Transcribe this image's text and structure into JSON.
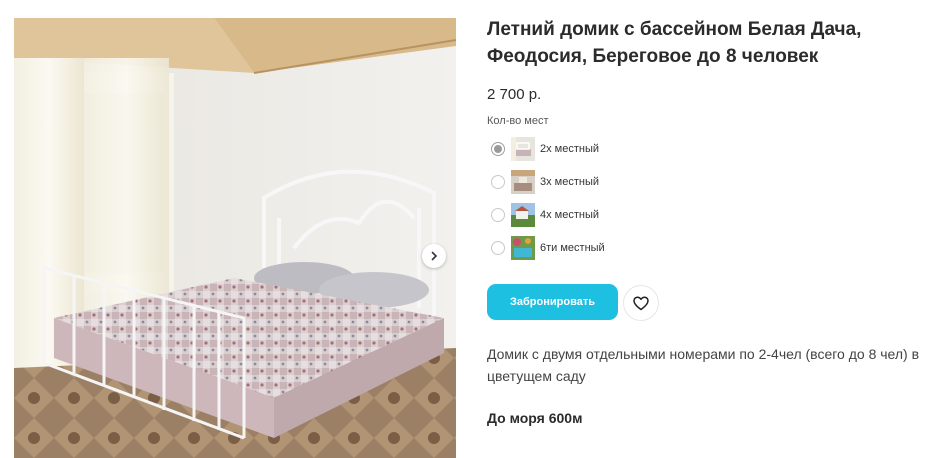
{
  "gallery": {
    "image_alt": "photo-bedroom-white-metal-bed",
    "next_icon": "chevron-right-icon"
  },
  "listing": {
    "title": "Летний домик с бассейном Белая Дача, Феодосия, Береговое до 8 человек",
    "price": "2 700 р.",
    "seats_label": "Кол-во мест",
    "options": [
      {
        "label": "2х местный",
        "selected": true,
        "thumb": "bedroom-thumb"
      },
      {
        "label": "3х местный",
        "selected": false,
        "thumb": "room-thumb"
      },
      {
        "label": "4х местный",
        "selected": false,
        "thumb": "garden-thumb"
      },
      {
        "label": "6ти местный",
        "selected": false,
        "thumb": "pool-thumb"
      }
    ],
    "book_label": "Забронировать",
    "favorite_icon": "heart-icon",
    "description": "Домик с двумя отдельными номерами по 2-4чел (всего до 8 чел) в цветущем саду",
    "sea_distance": "До моря 600м"
  },
  "colors": {
    "accent": "#1ec0e2",
    "text": "#2b2b2b",
    "muted": "#555555"
  }
}
